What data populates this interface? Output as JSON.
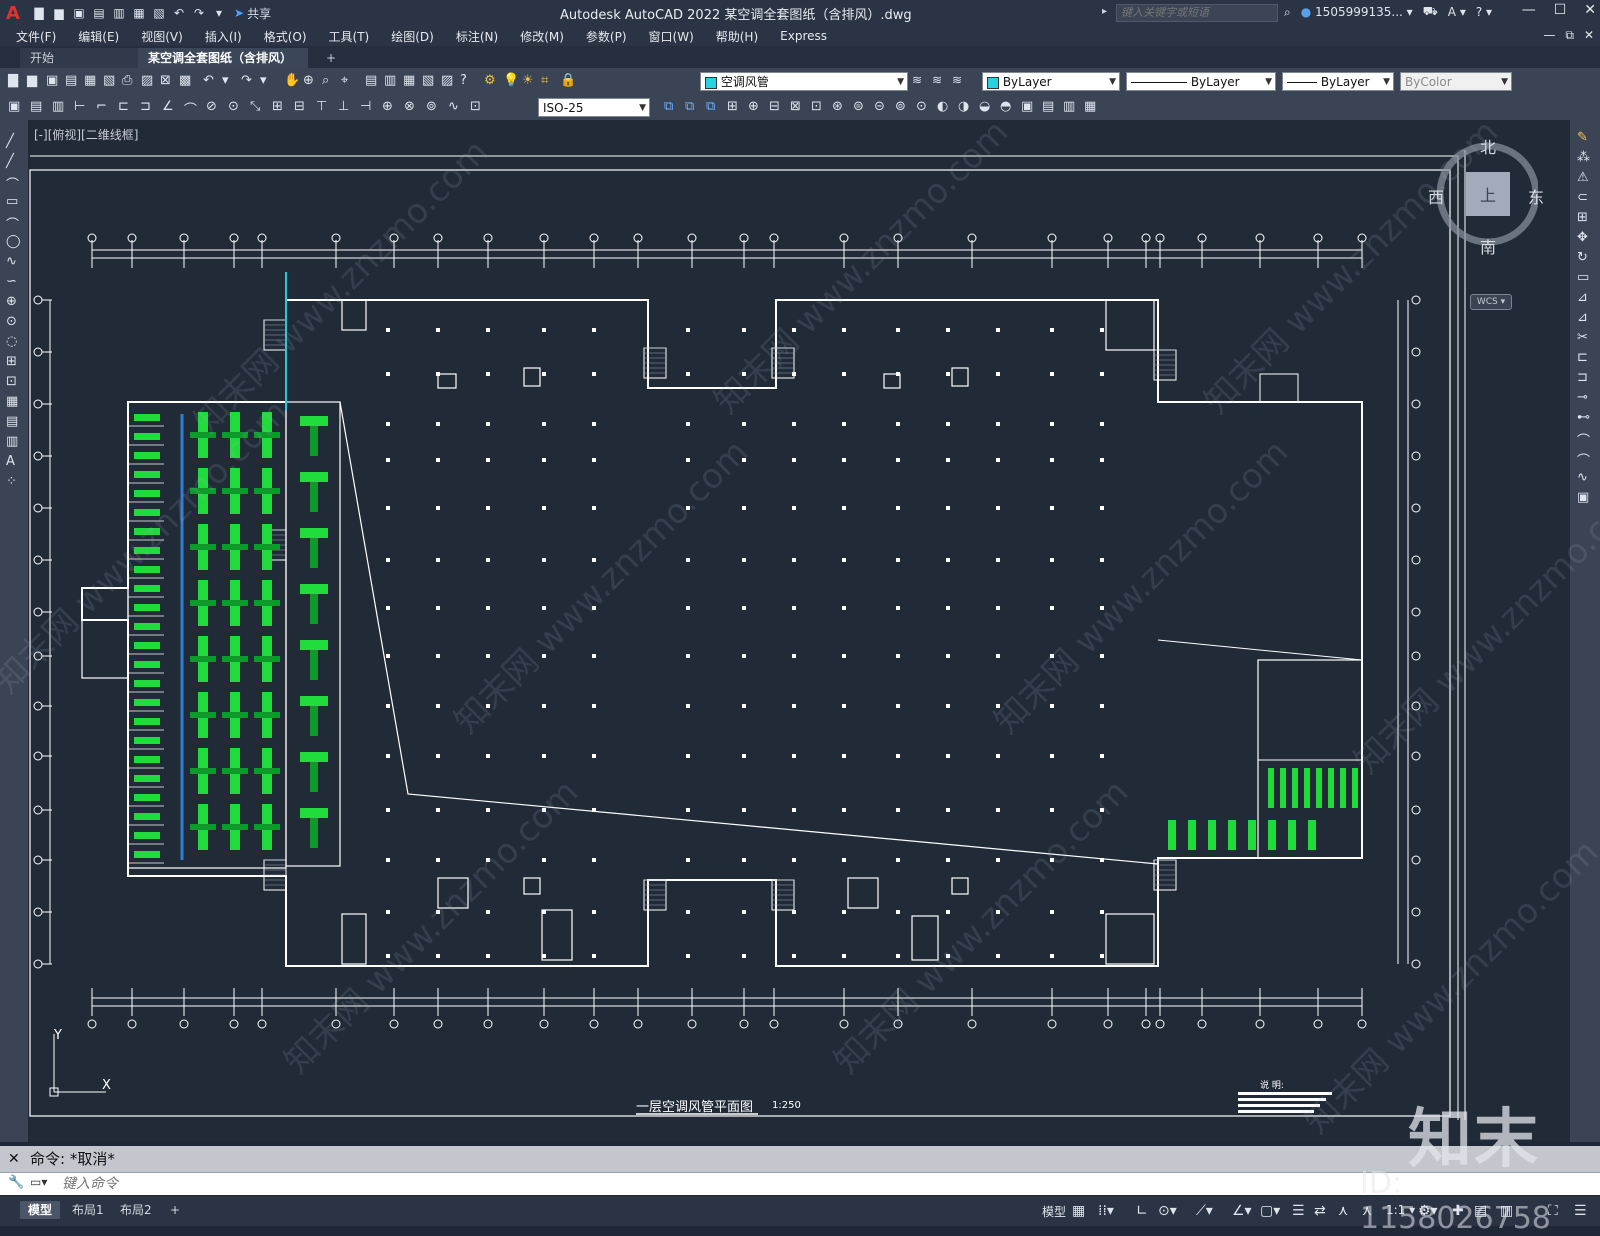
{
  "titlebar": {
    "app_title": "Autodesk AutoCAD 2022    某空调全套图纸（含排风）.dwg",
    "share": "共享",
    "search_placeholder": "键入关键字或短语",
    "user": "1505999135...",
    "help": "?"
  },
  "menu": [
    "文件(F)",
    "编辑(E)",
    "视图(V)",
    "插入(I)",
    "格式(O)",
    "工具(T)",
    "绘图(D)",
    "标注(N)",
    "修改(M)",
    "参数(P)",
    "窗口(W)",
    "帮助(H)",
    "Express"
  ],
  "tabs": {
    "start": "开始",
    "doc": "某空调全套图纸（含排风）*",
    "close": "×",
    "add": "+"
  },
  "properties": {
    "layer": "空调风管",
    "color": "ByLayer",
    "linetype": "ByLayer",
    "lineweight": "ByLayer",
    "plotstyle": "ByColor",
    "dimstyle": "ISO-25"
  },
  "viewport": {
    "label": "[-][俯视][二维线框]",
    "compass": {
      "n": "北",
      "s": "南",
      "w": "西",
      "e": "东",
      "top": "上"
    },
    "wcs": "WCS ▾"
  },
  "drawing": {
    "title": "一层空调风管平面图",
    "scale": "1:250",
    "ucs_x": "X",
    "ucs_y": "Y",
    "notes_title": "说  明:"
  },
  "command": {
    "history": "命令:  *取消*",
    "placeholder": "键入命令"
  },
  "status": {
    "layouts": [
      "模型",
      "布局1",
      "布局2"
    ],
    "add": "+",
    "model": "模型",
    "scale": "1:1"
  },
  "watermark": {
    "logo": "知末",
    "id": "ID: 1158026758",
    "repeat": "知末网 www.znzmo.com"
  },
  "colors": {
    "background": "#212a37",
    "wall": "#ffffff",
    "duct": "#1fdc3c",
    "duct_dark": "#0e9a2a",
    "accent_blue": "#2e7fd4",
    "cyan": "#27c8d6"
  }
}
